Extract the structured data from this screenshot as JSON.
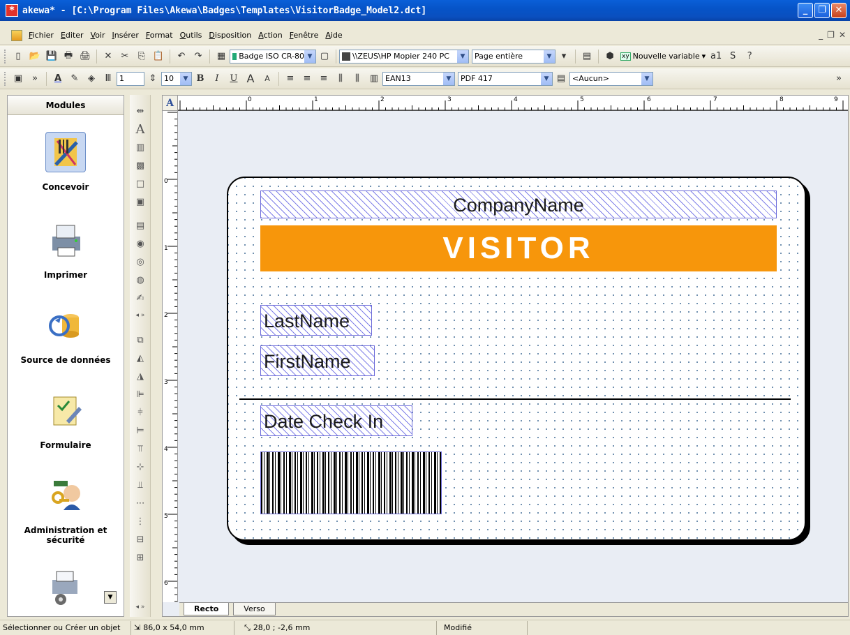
{
  "window": {
    "title": "akewa* - [C:\\Program Files\\Akewa\\Badges\\Templates\\VisitorBadge_Model2.dct]",
    "minimize": "_",
    "maximize": "❐",
    "close": "✕"
  },
  "menu": [
    "Fichier",
    "Editer",
    "Voir",
    "Insérer",
    "Format",
    "Outils",
    "Disposition",
    "Action",
    "Fenêtre",
    "Aide"
  ],
  "mdi_controls": {
    "minimize": "_",
    "restore": "❐",
    "close": "✕"
  },
  "toolbar1": {
    "badge_format": "Badge ISO CR-80",
    "printer": "\\\\ZEUS\\HP Mopier 240 PC",
    "zoom": "Page entière",
    "variable": "Nouvelle variable"
  },
  "toolbar2": {
    "line_width": "1",
    "font_size": "10",
    "barcode1": "EAN13",
    "barcode2": "PDF 417",
    "style": "<Aucun>"
  },
  "modules": {
    "header": "Modules",
    "items": [
      {
        "label": "Concevoir",
        "icon": "design-icon",
        "selected": true
      },
      {
        "label": "Imprimer",
        "icon": "printer-icon"
      },
      {
        "label": "Source de données",
        "icon": "database-icon"
      },
      {
        "label": "Formulaire",
        "icon": "form-icon"
      },
      {
        "label": "Administration et sécurité",
        "icon": "admin-icon"
      }
    ]
  },
  "rulers": {
    "horizontal": [
      "0",
      "1",
      "2",
      "3",
      "4",
      "5",
      "6",
      "7",
      "8",
      "9"
    ],
    "vertical": [
      "0",
      "1",
      "2",
      "3",
      "4",
      "5",
      "6"
    ]
  },
  "badge": {
    "company": "CompanyName",
    "visitor": "VISITOR",
    "visitor_color": "#f7960b",
    "lastname": "LastName",
    "firstname": "FirstName",
    "date_check_in": "Date Check In"
  },
  "tabs": [
    "Recto",
    "Verso"
  ],
  "status": {
    "hint": "Sélectionner ou Créer un objet",
    "size": "86,0 x 54,0 mm",
    "position": "28,0 ; -2,6 mm",
    "state": "Modifié"
  }
}
